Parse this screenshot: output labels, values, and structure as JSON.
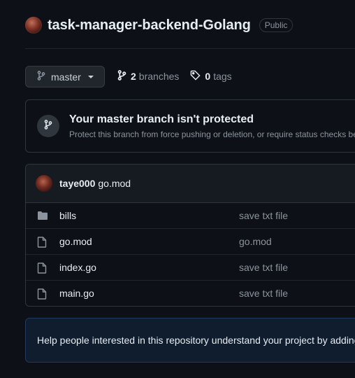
{
  "repo": {
    "name": "task-manager-backend-Golang",
    "visibility": "Public"
  },
  "branch_bar": {
    "current_branch": "master",
    "branches_count": "2",
    "branches_label": "branches",
    "tags_count": "0",
    "tags_label": "tags"
  },
  "protect_banner": {
    "title": "Your master branch isn't protected",
    "description": "Protect this branch from force pushing or deletion, or require status checks be"
  },
  "latest_commit": {
    "author": "taye000",
    "message": "go.mod"
  },
  "files": [
    {
      "name": "bills",
      "type": "folder",
      "commit": "save txt file"
    },
    {
      "name": "go.mod",
      "type": "file",
      "commit": "go.mod"
    },
    {
      "name": "index.go",
      "type": "file",
      "commit": "save txt file"
    },
    {
      "name": "main.go",
      "type": "file",
      "commit": "save txt file"
    }
  ],
  "readme_prompt": {
    "text": "Help people interested in this repository understand your project by adding"
  },
  "colors": {
    "background": "#0d1117",
    "border": "#30363d",
    "muted_text": "#8b949e",
    "primary_text": "#e6edf3",
    "readme_bg": "#0f1d2e"
  }
}
